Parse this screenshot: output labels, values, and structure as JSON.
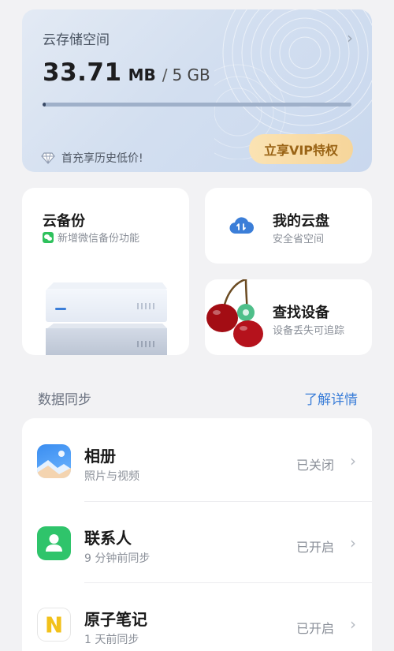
{
  "storage": {
    "title": "云存储空间",
    "used": "33.71",
    "used_unit": "MB",
    "separator": "/",
    "total": "5 GB",
    "usage_fraction": 0.0066,
    "promo": "首充享历史低价!",
    "vip_button": "立享VIP特权"
  },
  "tiles": {
    "backup": {
      "title": "云备份",
      "subtitle": "新增微信备份功能"
    },
    "cloud_drive": {
      "title": "我的云盘",
      "subtitle": "安全省空间"
    },
    "find_device": {
      "title": "查找设备",
      "subtitle": "设备丢失可追踪"
    }
  },
  "sync": {
    "section_label": "数据同步",
    "learn_more": "了解详情",
    "items": [
      {
        "name": "相册",
        "desc": "照片与视频",
        "status": "已关闭",
        "icon": "photos-icon"
      },
      {
        "name": "联系人",
        "desc": "9 分钟前同步",
        "status": "已开启",
        "icon": "contacts-icon"
      },
      {
        "name": "原子笔记",
        "desc": "1 天前同步",
        "status": "已开启",
        "icon": "notes-icon"
      }
    ]
  },
  "colors": {
    "accent": "#3b7ed8",
    "vip_text": "#9a6416",
    "contacts_green": "#2fc46b",
    "page_bg": "#f2f2f4"
  }
}
